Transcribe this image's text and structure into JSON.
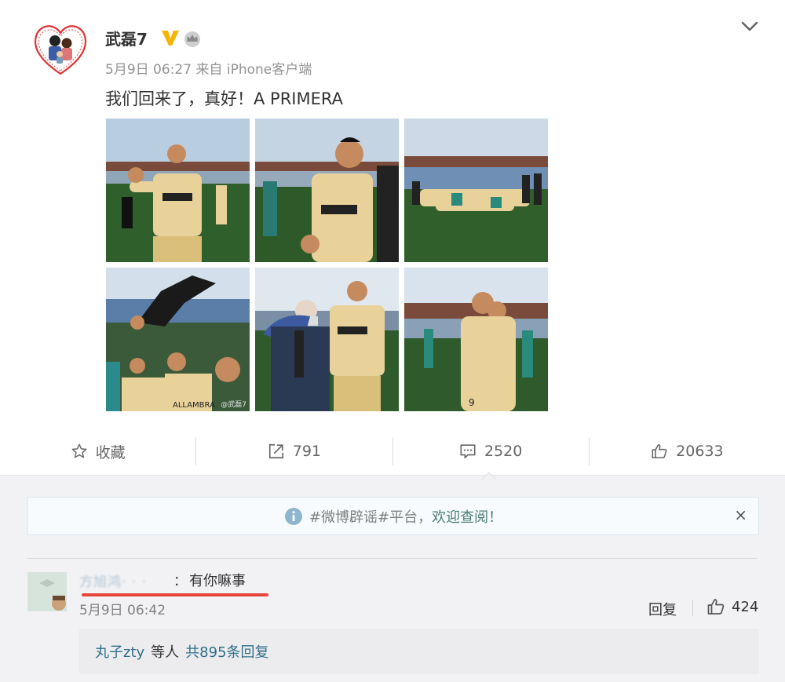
{
  "post": {
    "author": "武磊7",
    "timestamp": "5月9日 06:27",
    "source": "来自 iPhone客户端",
    "text": "我们回来了，真好！A PRIMERA",
    "photo_watermark": "@武磊7",
    "icons": {
      "verified": "verified-v-icon",
      "crown": "crown-icon",
      "menu": "chevron-down-icon"
    }
  },
  "actions": {
    "favorite_label": "收藏",
    "repost_count": "791",
    "comment_count": "2520",
    "like_count": "20633"
  },
  "notice": {
    "text_prefix": "#微博辟谣#平台，",
    "link_text": "欢迎查阅！",
    "close": "×"
  },
  "comment": {
    "username": "方旭鸿· · ·",
    "colon": "：",
    "text": "有你嘛事",
    "time": "5月9日 06:42",
    "reply_label": "回复",
    "like_count": "424"
  },
  "replies": {
    "user": "丸子zty",
    "middle": "等人",
    "more": "共895条回复"
  },
  "colors": {
    "link": "#2f6f88",
    "accent_gold": "#f5b400",
    "underline_red": "#e8453a",
    "jersey": "#e8d29a",
    "pitch": "#2f5f2a"
  }
}
